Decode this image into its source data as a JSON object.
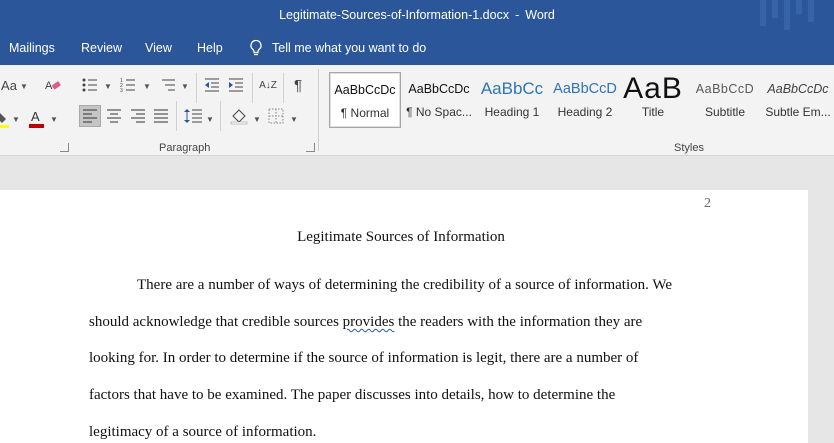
{
  "titlebar": {
    "filename": "Legitimate-Sources-of-Information-1.docx",
    "separator": "-",
    "app": "Word"
  },
  "tabs": [
    "Mailings",
    "Review",
    "View",
    "Help"
  ],
  "tell_me": "Tell me what you want to do",
  "ribbon": {
    "font_case_label": "Aa",
    "paragraph_label": "Paragraph",
    "styles_label": "Styles",
    "font_color": "#c00000",
    "highlight_color": "#ffff00",
    "sort_label": "A↓Z",
    "pilcrow": "¶"
  },
  "styles": [
    {
      "sample": "AaBbCcDc",
      "name": "¶ Normal"
    },
    {
      "sample": "AaBbCcDc",
      "name": "¶ No Spac..."
    },
    {
      "sample": "AaBbCc",
      "name": "Heading 1"
    },
    {
      "sample": "AaBbCcD",
      "name": "Heading 2"
    },
    {
      "sample": "AaB",
      "name": "Title"
    },
    {
      "sample": "AaBbCcD",
      "name": "Subtitle"
    },
    {
      "sample": "AaBbCcDc",
      "name": "Subtle Em..."
    }
  ],
  "document": {
    "page_number": "2",
    "title": "Legitimate Sources of Information",
    "lines": [
      "There are a number of ways of determining the credibility of a source of information. We",
      "should acknowledge that credible sources",
      "provides",
      "the readers with the information they are",
      "looking for. In order to determine if the source of information is legit, there are a number of",
      "factors that have to be examined. The paper discusses into details, how to determine the",
      "legitimacy of a source of information."
    ]
  }
}
